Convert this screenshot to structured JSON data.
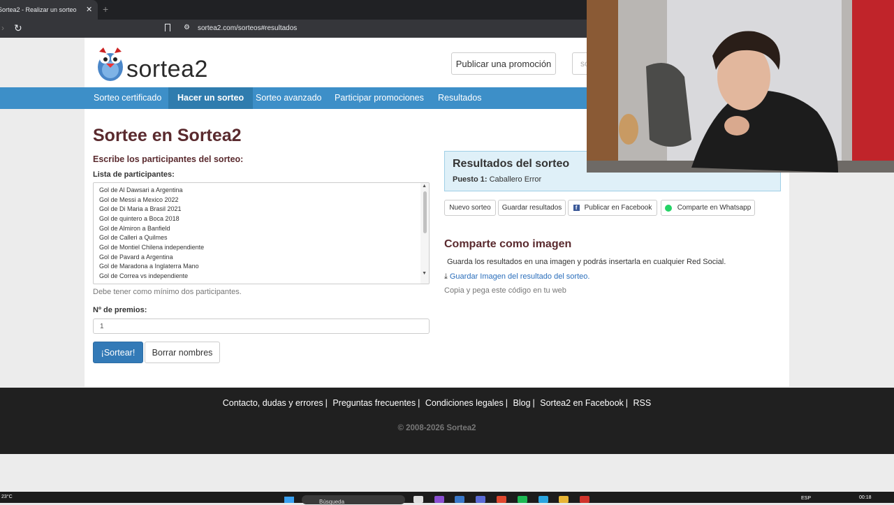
{
  "browser": {
    "tab_title": "Sortea2 - Realizar un sorteo",
    "tab_close": "✕",
    "new_tab": "+",
    "url": "sortea2.com/sorteos#resultados"
  },
  "header": {
    "logo_text": "sortea2",
    "promo_button": "Publicar una promoción",
    "search_placeholder": "so"
  },
  "nav": {
    "items": [
      "Sorteo certificado",
      "Hacer un sorteo",
      "Sorteo avanzado",
      "Participar promociones",
      "Resultados"
    ],
    "active_index": 1
  },
  "form": {
    "title": "Sortee en Sortea2",
    "subtitle": "Escribe los participantes del sorteo:",
    "list_label": "Lista de participantes:",
    "participants": [
      "Gol de Al Dawsari a Argentina",
      "Gol de Messi a Mexico 2022",
      "Gol de Di Maria a Brasil 2021",
      "Gol de quintero a Boca 2018",
      "Gol de Almiron a Banfield",
      "Gol de Calleri a Quilmes",
      "Gol de Montiel Chilena independiente",
      "Gol de Pavard a Argentina",
      "Gol de Maradona a Inglaterra Mano",
      "Gol de Correa vs independiente"
    ],
    "hint": "Debe tener como mínimo dos participantes.",
    "prizes_label": "Nº de premios:",
    "prizes_value": "1",
    "submit_label": "¡Sortear!",
    "clear_label": "Borrar nombres"
  },
  "results": {
    "title": "Resultados del sorteo",
    "place_label": "Puesto 1:",
    "place_value": "Caballero Error",
    "buttons": {
      "new": "Nuevo sorteo",
      "save": "Guardar resultados",
      "facebook": "Publicar en Facebook",
      "whatsapp": "Comparte en Whatsapp"
    }
  },
  "share": {
    "title": "Comparte como imagen",
    "text": "Guarda los resultados en una imagen y podrás insertarla en cualquier Red Social.",
    "download_link": "Guardar Imagen del resultado del sorteo.",
    "copy_text": "Copia y pega este código en tu web"
  },
  "footer": {
    "links": [
      "Contacto, dudas y errores",
      "Preguntas frecuentes",
      "Condiciones legales",
      "Blog",
      "Sortea2 en Facebook",
      "RSS"
    ],
    "copyright": "© 2008-2026 Sortea2"
  },
  "taskbar": {
    "weather": "23°C",
    "search_placeholder": "Búsqueda",
    "language": "ESP",
    "time": "00:18"
  },
  "colors": {
    "nav_bg": "#3d8fc8",
    "heading": "#5a2a2e",
    "primary_button": "#337ab7",
    "result_bg": "#dff0f8",
    "footer_bg": "#202020"
  }
}
